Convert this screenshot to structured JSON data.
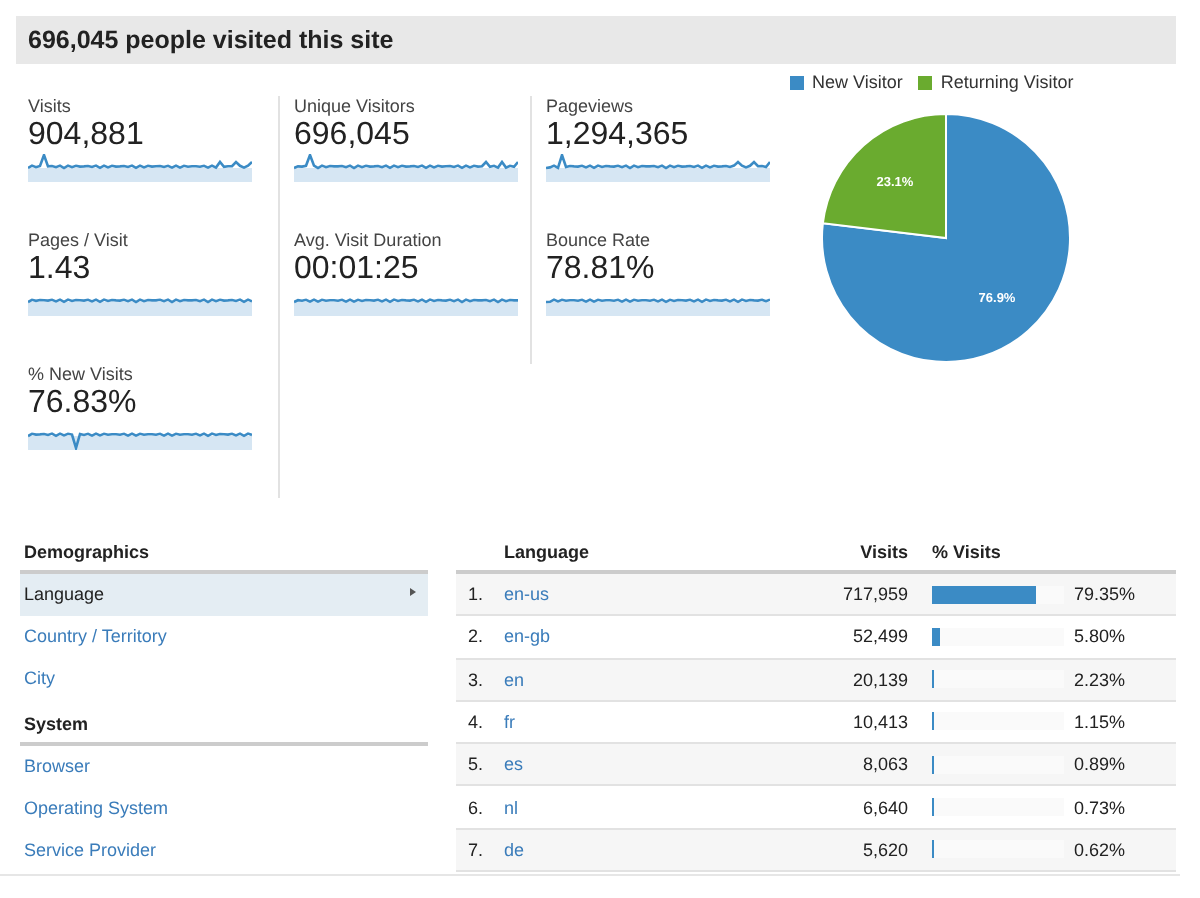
{
  "header": {
    "title": "696,045 people visited this site"
  },
  "metrics": [
    {
      "label": "Visits",
      "value": "904,881"
    },
    {
      "label": "Unique Visitors",
      "value": "696,045"
    },
    {
      "label": "Pageviews",
      "value": "1,294,365"
    },
    {
      "label": "Pages / Visit",
      "value": "1.43"
    },
    {
      "label": "Avg. Visit Duration",
      "value": "00:01:25"
    },
    {
      "label": "Bounce Rate",
      "value": "78.81%"
    },
    {
      "label": "% New Visits",
      "value": "76.83%"
    }
  ],
  "visitor_chart": {
    "chart_data": {
      "type": "pie",
      "categories": [
        "New Visitor",
        "Returning Visitor"
      ],
      "series": [
        {
          "colors": [
            "#3b8bc5",
            "#6aab2f"
          ],
          "values": [
            76.9,
            23.1
          ]
        }
      ],
      "value_labels": [
        "76.9%",
        "23.1%"
      ],
      "legend": "top"
    }
  },
  "sidebar": {
    "sections": [
      {
        "title": "Demographics",
        "items": [
          {
            "label": "Language",
            "selected": true
          },
          {
            "label": "Country / Territory",
            "selected": false
          },
          {
            "label": "City",
            "selected": false
          }
        ]
      },
      {
        "title": "System",
        "items": [
          {
            "label": "Browser",
            "selected": false
          },
          {
            "label": "Operating System",
            "selected": false
          },
          {
            "label": "Service Provider",
            "selected": false
          }
        ]
      }
    ]
  },
  "table": {
    "columns": [
      "Language",
      "Visits",
      "% Visits"
    ],
    "rows": [
      {
        "rank": "1.",
        "language": "en-us",
        "visits": "717,959",
        "level": 0.7935,
        "percent": "79.35%"
      },
      {
        "rank": "2.",
        "language": "en-gb",
        "visits": "52,499",
        "level": 0.058,
        "percent": "5.80%"
      },
      {
        "rank": "3.",
        "language": "en",
        "visits": "20,139",
        "level": 0.0223,
        "percent": "2.23%"
      },
      {
        "rank": "4.",
        "language": "fr",
        "visits": "10,413",
        "level": 0.0115,
        "percent": "1.15%"
      },
      {
        "rank": "5.",
        "language": "es",
        "visits": "8,063",
        "level": 0.0089,
        "percent": "0.89%"
      },
      {
        "rank": "6.",
        "language": "nl",
        "visits": "6,640",
        "level": 0.0073,
        "percent": "0.73%"
      },
      {
        "rank": "7.",
        "language": "de",
        "visits": "5,620",
        "level": 0.0062,
        "percent": "0.62%"
      }
    ]
  }
}
